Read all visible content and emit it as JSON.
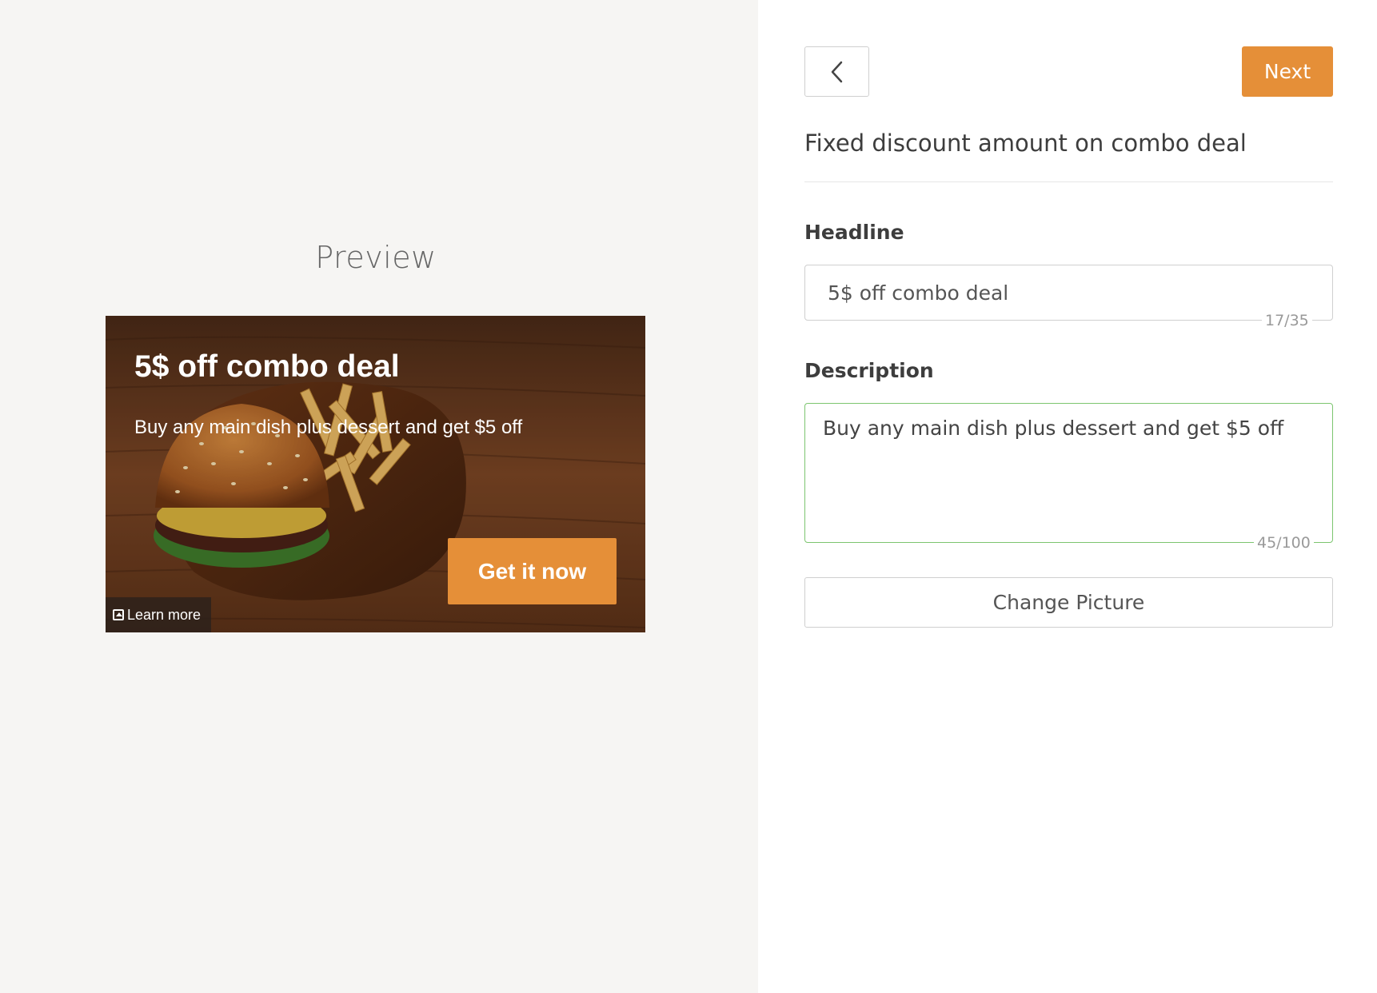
{
  "preview": {
    "title": "Preview",
    "ad": {
      "headline": "5$ off combo deal",
      "description": "Buy any main dish plus dessert and get $5 off",
      "cta_label": "Get it now",
      "learn_more_label": "Learn more",
      "image_icon": "image-icon"
    }
  },
  "form": {
    "back_icon": "chevron-left-icon",
    "next_label": "Next",
    "title": "Fixed discount amount on combo deal",
    "headline": {
      "label": "Headline",
      "value": "5$ off combo deal",
      "counter": "17/35"
    },
    "description": {
      "label": "Description",
      "value": "Buy any main dish plus dessert and get $5 off",
      "counter": "45/100"
    },
    "change_picture_label": "Change Picture"
  },
  "colors": {
    "accent": "#e58f38",
    "focus_border": "#7cc56f",
    "preview_bg": "#f6f5f3"
  }
}
